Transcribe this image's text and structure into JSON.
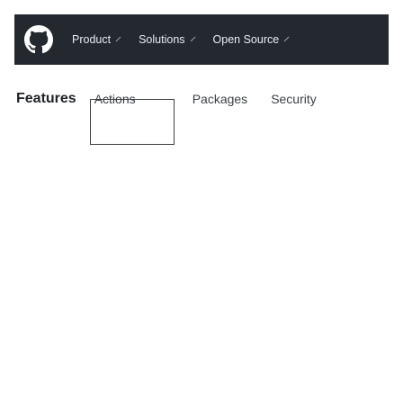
{
  "header": {
    "logo_icon": "github-mark-icon",
    "nav": [
      {
        "label": "Product"
      },
      {
        "label": "Solutions"
      },
      {
        "label": "Open Source"
      }
    ],
    "background": "#24292f"
  },
  "subnav": {
    "title": "Features",
    "items": [
      {
        "label": "Actions",
        "active": true
      },
      {
        "label": "Packages"
      },
      {
        "label": "Security"
      }
    ]
  }
}
